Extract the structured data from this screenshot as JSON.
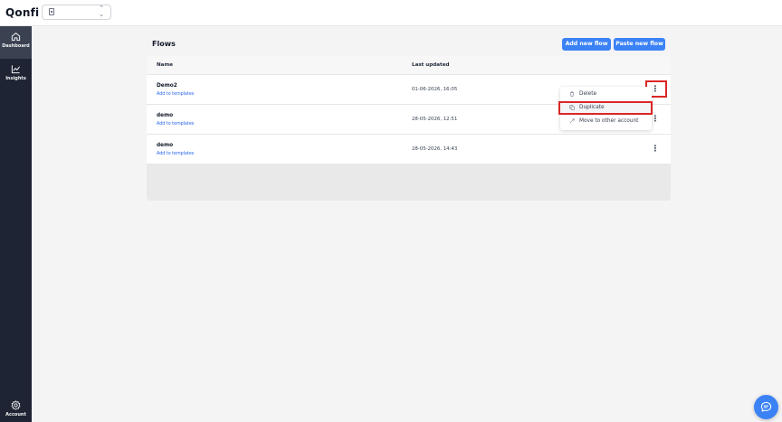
{
  "app": {
    "logo": "Qonfi"
  },
  "sidebar": {
    "items": [
      {
        "label": "Dashboard",
        "icon": "home-icon",
        "active": true
      },
      {
        "label": "Insights",
        "icon": "chart-line-icon",
        "active": false
      },
      {
        "label": "Account",
        "icon": "gear-icon",
        "active": false
      }
    ]
  },
  "main": {
    "title": "Flows",
    "buttons": {
      "add_new_flow": "Add new flow",
      "paste_new_flow": "Paste new flow"
    },
    "table": {
      "columns": [
        "Name",
        "Last updated"
      ],
      "rows": [
        {
          "name": "Demo2",
          "link": "Add to templates",
          "last_updated": "01-06-2026, 16:05"
        },
        {
          "name": "demo",
          "link": "Add to templates",
          "last_updated": "28-05-2026, 12:51"
        },
        {
          "name": "demo",
          "link": "Add to templates",
          "last_updated": "28-05-2026, 14:43"
        }
      ]
    }
  },
  "context_menu": {
    "items": [
      {
        "label": "Delete",
        "icon": "trash-icon"
      },
      {
        "label": "Duplicate",
        "icon": "copy-icon"
      },
      {
        "label": "Move to other account",
        "icon": "move-icon"
      }
    ]
  },
  "colors": {
    "accent": "#3b82f6",
    "sidebar_bg": "#1e2433",
    "highlight": "#dc2626",
    "link": "#2563eb"
  }
}
